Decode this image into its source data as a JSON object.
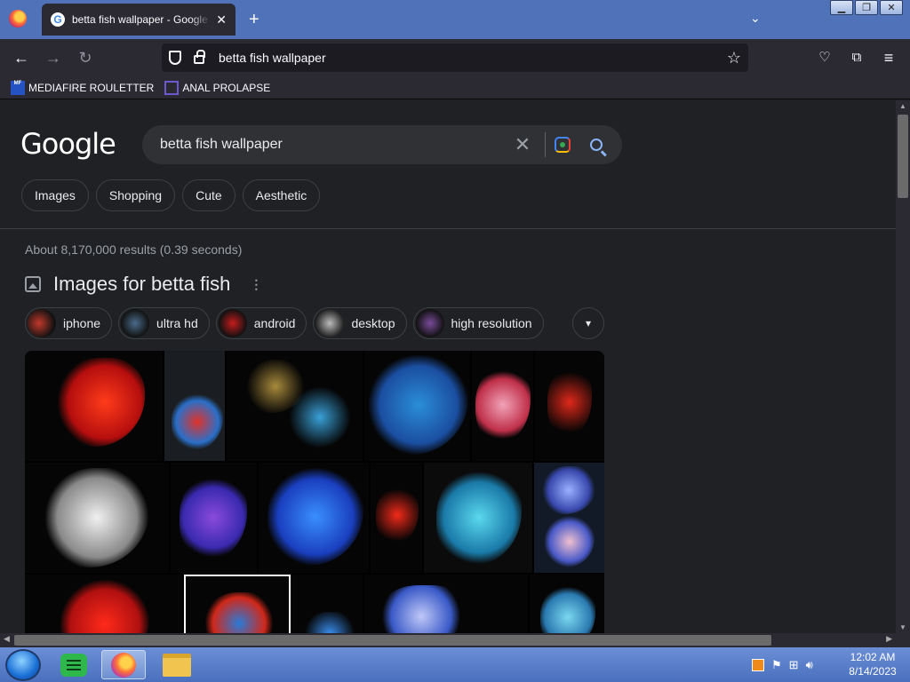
{
  "browser": {
    "tab_title": "betta fish wallpaper - Google Search",
    "tab_close": "✕",
    "new_tab": "+",
    "url": "betta fish wallpaper",
    "bookmarks": [
      {
        "label": "MEDIAFIRE ROULETTER",
        "icon": "MF"
      },
      {
        "label": "ANAL PROLAPSE"
      }
    ]
  },
  "search": {
    "logo": "Google",
    "query": "betta fish wallpaper",
    "chips": [
      "Images",
      "Shopping",
      "Cute",
      "Aesthetic"
    ],
    "stats": "About 8,170,000 results (0.39 seconds)"
  },
  "images_section": {
    "title": "Images for betta fish",
    "refinements": [
      {
        "label": "iphone",
        "color": "#c0392b"
      },
      {
        "label": "ultra hd",
        "color": "#2a4a6a"
      },
      {
        "label": "android",
        "color": "#b01818"
      },
      {
        "label": "desktop",
        "color": "#9a9a9a"
      },
      {
        "label": "high resolution",
        "color": "#5a3a7a"
      }
    ]
  },
  "taskbar": {
    "time": "12:02 AM",
    "date": "8/14/2023"
  },
  "colors": {
    "page_bg": "#202124",
    "tab_strip": "#4f72b8",
    "toolbar": "#2b2a33"
  }
}
